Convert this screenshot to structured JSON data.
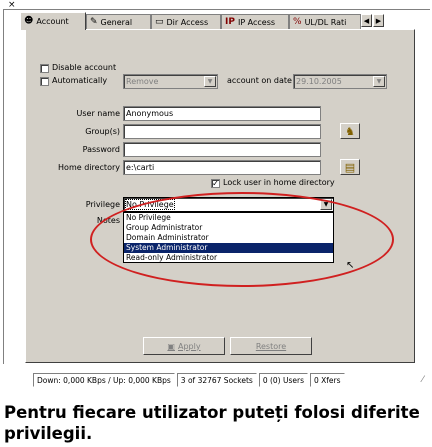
{
  "tabs": [
    {
      "label": "Account",
      "icon": "user-icon"
    },
    {
      "label": "General",
      "icon": "document-icon"
    },
    {
      "label": "Dir Access",
      "icon": "folder-icon"
    },
    {
      "label": "IP Access",
      "icon": "ip-icon"
    },
    {
      "label": "UL/DL Rati",
      "icon": "ratio-icon"
    }
  ],
  "account": {
    "disable_label": "Disable account",
    "auto_label": "Automatically",
    "auto_action_value": "Remove",
    "account_on_date_label": "account on date",
    "date_value": "29.10.2005"
  },
  "form": {
    "username_label": "User name",
    "username_value": "Anonymous",
    "groups_label": "Group(s)",
    "groups_value": "",
    "password_label": "Password",
    "password_value": "",
    "homedir_label": "Home directory",
    "homedir_value": "e:\\carti",
    "lock_label": "Lock user in home directory",
    "privilege_label": "Privilege",
    "privilege_value": "No Privilege",
    "notes_label": "Notes"
  },
  "privilege_options": [
    "No Privilege",
    "Group Administrator",
    "Domain Administrator",
    "System Administrator",
    "Read-only Administrator"
  ],
  "privilege_selected_index": 3,
  "buttons": {
    "apply": "Apply",
    "restore": "Restore"
  },
  "status": {
    "transfer": "Down: 0,000 KBps / Up: 0,000 KBps",
    "sockets": "3 of 32767 Sockets",
    "users": "0 (0) Users",
    "xfers": "0 Xfers"
  },
  "caption": "Pentru fiecare utilizator puteți folosi diferite privilegii.",
  "colors": {
    "selection": "#0a246a",
    "annotation": "#d02020",
    "dialog": "#d4d0c8"
  }
}
